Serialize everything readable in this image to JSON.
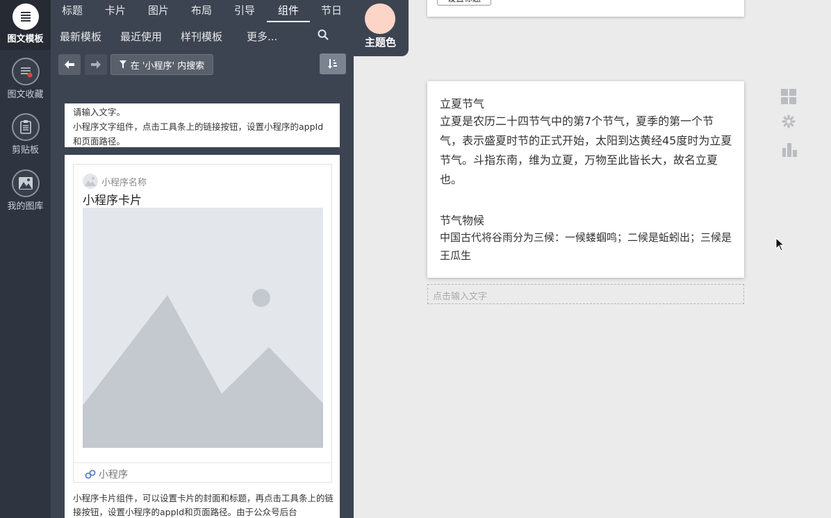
{
  "rail": {
    "items": [
      {
        "label": "图文模板"
      },
      {
        "label": "图文收藏"
      },
      {
        "label": "剪贴板"
      },
      {
        "label": "我的图库"
      }
    ]
  },
  "tabs": [
    "标题",
    "卡片",
    "图片",
    "布局",
    "引导",
    "组件",
    "节日"
  ],
  "subtabs": [
    "最新模板",
    "最近使用",
    "样刊模板",
    "更多..."
  ],
  "toolbar": {
    "filter_label": "在 '小程序' 内搜索"
  },
  "theme": {
    "label": "主题色",
    "color": "#fcd5c6"
  },
  "panel": {
    "text_card": {
      "line1": "请输入文字。",
      "line2": "小程序文字组件，点击工具条上的链接按钮，设置小程序的appId和页面路径。"
    },
    "mini_card": {
      "name": "小程序名称",
      "title": "小程序卡片",
      "footer": "小程序",
      "desc": "小程序卡片组件，可以设置卡片的封面和标题，再点击工具条上的链接按钮，设置小程序的appId和页面路径。由于公众号后台"
    }
  },
  "editor": {
    "top_button": "设置标题",
    "article": {
      "heading1": "立夏节气",
      "para1": "立夏是农历二十四节气中的第7个节气，夏季的第一个节气，表示盛夏时节的正式开始，太阳到达黄经45度时为立夏节气。斗指东南，维为立夏，万物至此皆长大，故名立夏也。",
      "heading2": "节气物候",
      "para2": "中国古代将谷雨分为三候：一候蝼蝈鸣；二候是蚯蚓出；三候是王瓜生"
    },
    "input_placeholder": "点击输入文字"
  },
  "icons": [
    "list-icon",
    "bookmark-icon",
    "clipboard-icon",
    "gallery-icon",
    "search-icon",
    "arrow-left-icon",
    "arrow-right-icon",
    "filter-icon",
    "sort-icon",
    "grid-icon",
    "settings-icon",
    "chart-icon",
    "link-icon",
    "cursor-icon"
  ]
}
